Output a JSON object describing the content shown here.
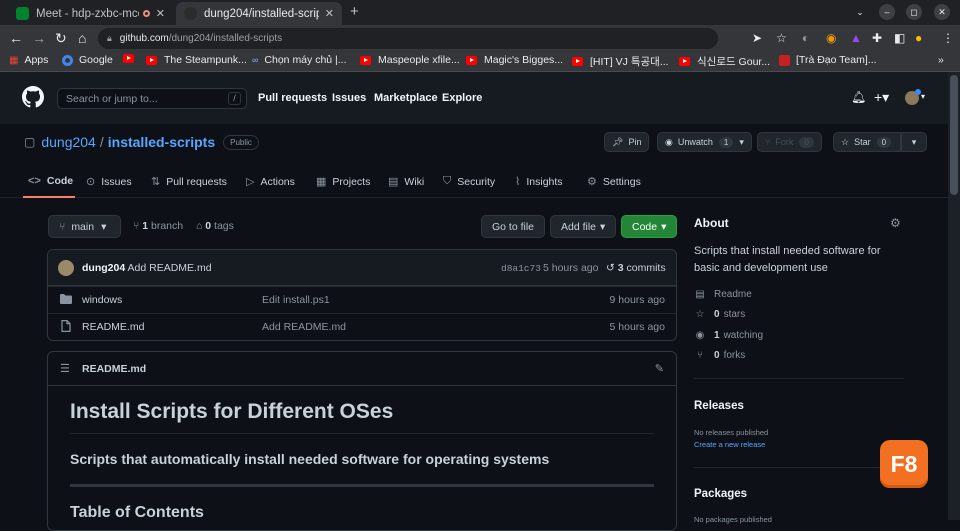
{
  "browser": {
    "tabs": [
      {
        "title": "Meet - hdp-zxbc-mco",
        "icon": "google-meet-icon"
      },
      {
        "title": "dung204/installed-scripts",
        "icon": "github-icon"
      }
    ],
    "address": {
      "host": "github.com",
      "path": "/dung204/installed-scripts"
    },
    "bookmarks": [
      {
        "label": "Apps"
      },
      {
        "label": "Google"
      },
      {
        "label": ""
      },
      {
        "label": "The Steampunk..."
      },
      {
        "label": "Chọn máy chủ |..."
      },
      {
        "label": "Maspeople xfile..."
      },
      {
        "label": "Magic's Bigges..."
      },
      {
        "label": "[HIT] VJ 특공대..."
      },
      {
        "label": "식신로드 Gour..."
      },
      {
        "label": "[Trà Đạo Team]..."
      }
    ]
  },
  "github": {
    "search_placeholder": "Search or jump to...",
    "search_key": "/",
    "nav": [
      "Pull requests",
      "Issues",
      "Marketplace",
      "Explore"
    ]
  },
  "repo": {
    "owner": "dung204",
    "name": "installed-scripts",
    "visibility": "Public",
    "pin": "Pin",
    "unwatch": "Unwatch",
    "watch_count": "1",
    "fork": "Fork",
    "fork_count": "0",
    "star": "Star",
    "star_count": "0",
    "tabs": [
      "Code",
      "Issues",
      "Pull requests",
      "Actions",
      "Projects",
      "Wiki",
      "Security",
      "Insights",
      "Settings"
    ]
  },
  "code": {
    "branch": "main",
    "branches_count": "1",
    "branches_label": "branch",
    "tags_count": "0",
    "tags_label": "tags",
    "goto_file": "Go to file",
    "add_file": "Add file",
    "code_btn": "Code",
    "commit": {
      "author": "dung204",
      "message": "Add README.md",
      "hash": "d8a1c73",
      "time": "5 hours ago",
      "count": "3",
      "count_label": "commits"
    },
    "files": [
      {
        "name": "windows",
        "type": "folder",
        "message": "Edit install.ps1",
        "age": "9 hours ago"
      },
      {
        "name": "README.md",
        "type": "file",
        "message": "Add README.md",
        "age": "5 hours ago"
      }
    ]
  },
  "readme": {
    "filename": "README.md",
    "h1": "Install Scripts for Different OSes",
    "h3": "Scripts that automatically install needed software for operating systems",
    "h2": "Table of Contents"
  },
  "about": {
    "heading": "About",
    "description": "Scripts that install needed software for basic and development use",
    "readme": "Readme",
    "stars_count": "0",
    "stars_label": "stars",
    "watching_count": "1",
    "watching_label": "watching",
    "forks_count": "0",
    "forks_label": "forks"
  },
  "releases": {
    "heading": "Releases",
    "none": "No releases published",
    "create": "Create a new release"
  },
  "packages": {
    "heading": "Packages",
    "none": "No packages published"
  },
  "overlay": {
    "badge": "F8"
  }
}
